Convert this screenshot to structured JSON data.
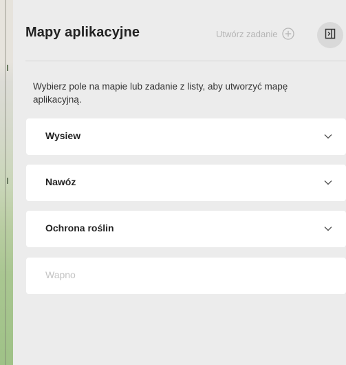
{
  "panel": {
    "title": "Mapy aplikacyjne",
    "create_task_label": "Utwórz zadanie",
    "description": "Wybierz pole na mapie lub zadanie z listy, aby utworzyć mapę aplikacyjną."
  },
  "icons": {
    "create": "plus-circle-icon",
    "collapse": "panel-collapse-icon",
    "expand": "chevron-down-icon"
  },
  "sections": [
    {
      "label": "Wysiew",
      "enabled": true
    },
    {
      "label": "Nawóz",
      "enabled": true
    },
    {
      "label": "Ochrona roślin",
      "enabled": true
    },
    {
      "label": "Wapno",
      "enabled": false
    }
  ],
  "colors": {
    "background": "#ececec",
    "card": "#ffffff",
    "muted_text": "#b5b5b5",
    "disabled_text": "#c3c3c3"
  }
}
